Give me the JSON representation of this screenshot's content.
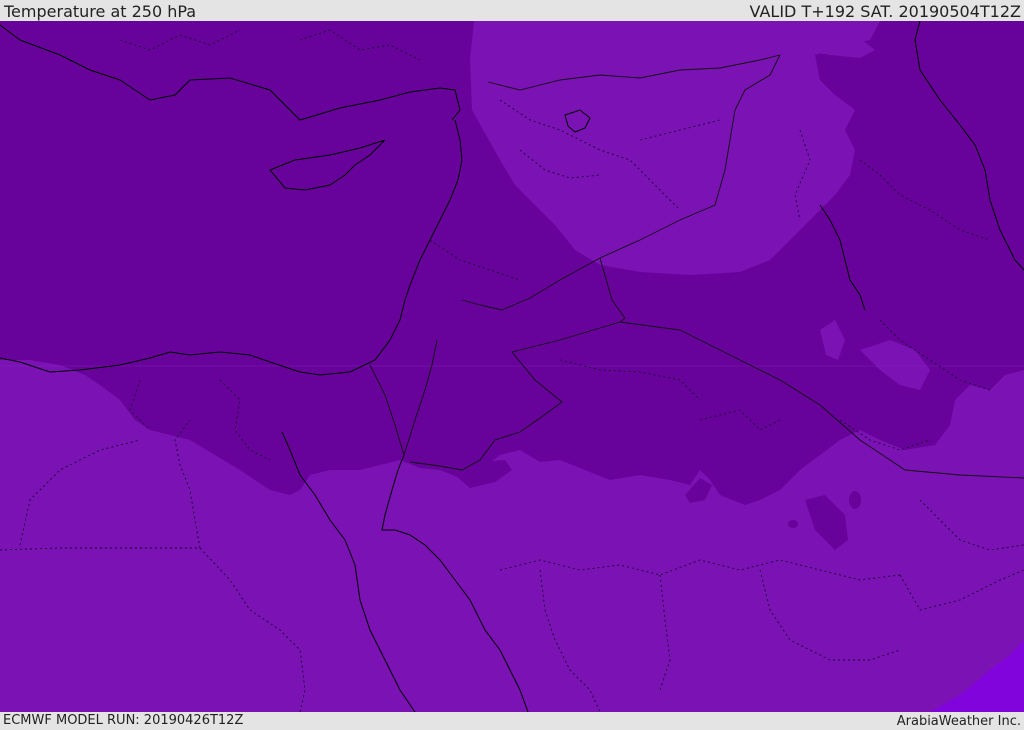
{
  "header": {
    "title": "Temperature at 250 hPa",
    "valid": "VALID T+192 SAT. 20190504T12Z"
  },
  "footer": {
    "model_run": "ECMWF MODEL RUN: 20190426T12Z",
    "credit": "ArabiaWeather Inc."
  },
  "colors": {
    "cold_band": "#67039a",
    "mid_band": "#7a12b4",
    "warm_band": "#8204dc",
    "coastline": "#000000",
    "border": "#1a0030",
    "admin": "#2a0a40",
    "bar_bg": "#e4e4e4"
  }
}
